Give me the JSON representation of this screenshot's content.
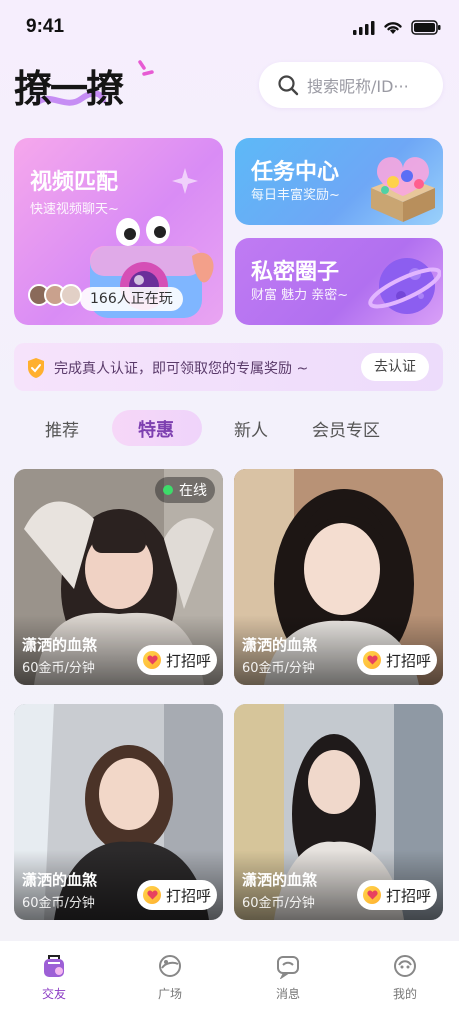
{
  "status": {
    "time": "9:41"
  },
  "header": {
    "logo": "撩一撩",
    "search_placeholder": "搜索昵称/ID···"
  },
  "cards": {
    "video": {
      "title": "视频匹配",
      "subtitle": "快速视频聊天~",
      "online": "166人正在玩"
    },
    "task": {
      "title": "任务中心",
      "subtitle": "每日丰富奖励~"
    },
    "private": {
      "title": "私密圈子",
      "subtitle": "财富 魅力 亲密~"
    }
  },
  "verify": {
    "text": "完成真人认证，即可领取您的专属奖励 ~",
    "button": "去认证"
  },
  "tabs": [
    {
      "label": "推荐"
    },
    {
      "label": "特惠"
    },
    {
      "label": "新人"
    },
    {
      "label": "会员专区"
    }
  ],
  "profiles": [
    {
      "name": "潇洒的血煞",
      "price": "60金币/分钟",
      "greet": "打招呼",
      "online": "在线"
    },
    {
      "name": "潇洒的血煞",
      "price": "60金币/分钟",
      "greet": "打招呼"
    },
    {
      "name": "潇洒的血煞",
      "price": "60金币/分钟",
      "greet": "打招呼"
    },
    {
      "name": "潇洒的血煞",
      "price": "60金币/分钟",
      "greet": "打招呼"
    }
  ],
  "nav": [
    {
      "label": "交友",
      "icon": "friends-icon"
    },
    {
      "label": "广场",
      "icon": "plaza-icon"
    },
    {
      "label": "消息",
      "icon": "message-icon"
    },
    {
      "label": "我的",
      "icon": "profile-icon"
    }
  ],
  "colors": {
    "accent": "#8b3bc4",
    "tab_active": "#7d3fb0",
    "online": "#3ddc6a"
  }
}
